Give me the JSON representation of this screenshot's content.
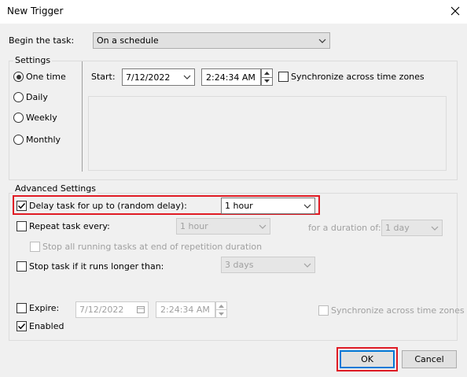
{
  "window": {
    "title": "New Trigger"
  },
  "begin_task": {
    "label": "Begin the task:",
    "value": "On a schedule"
  },
  "settings": {
    "group_label": "Settings",
    "radios": [
      {
        "label": "One time",
        "selected": true
      },
      {
        "label": "Daily",
        "selected": false
      },
      {
        "label": "Weekly",
        "selected": false
      },
      {
        "label": "Monthly",
        "selected": false
      }
    ],
    "start_label": "Start:",
    "start_date": "7/12/2022",
    "start_time": "2:24:34 AM",
    "sync_label": "Synchronize across time zones"
  },
  "advanced": {
    "group_label": "Advanced Settings",
    "delay": {
      "label": "Delay task for up to (random delay):",
      "checked": true,
      "value": "1 hour"
    },
    "repeat": {
      "label": "Repeat task every:",
      "checked": false,
      "value": "1 hour",
      "duration_label": "for a duration of:",
      "duration_value": "1 day"
    },
    "stop_running": {
      "label": "Stop all running tasks at end of repetition duration"
    },
    "stop_longer": {
      "label": "Stop task if it runs longer than:",
      "checked": false,
      "value": "3 days"
    },
    "expire": {
      "label": "Expire:",
      "checked": false,
      "date": "7/12/2022",
      "time": "2:24:34 AM",
      "sync_label": "Synchronize across time zones"
    },
    "enabled": {
      "label": "Enabled",
      "checked": true
    }
  },
  "buttons": {
    "ok": "OK",
    "cancel": "Cancel"
  },
  "colors": {
    "accent": "#0078d7",
    "highlight": "#e01b24",
    "background": "#f0f0f0"
  }
}
